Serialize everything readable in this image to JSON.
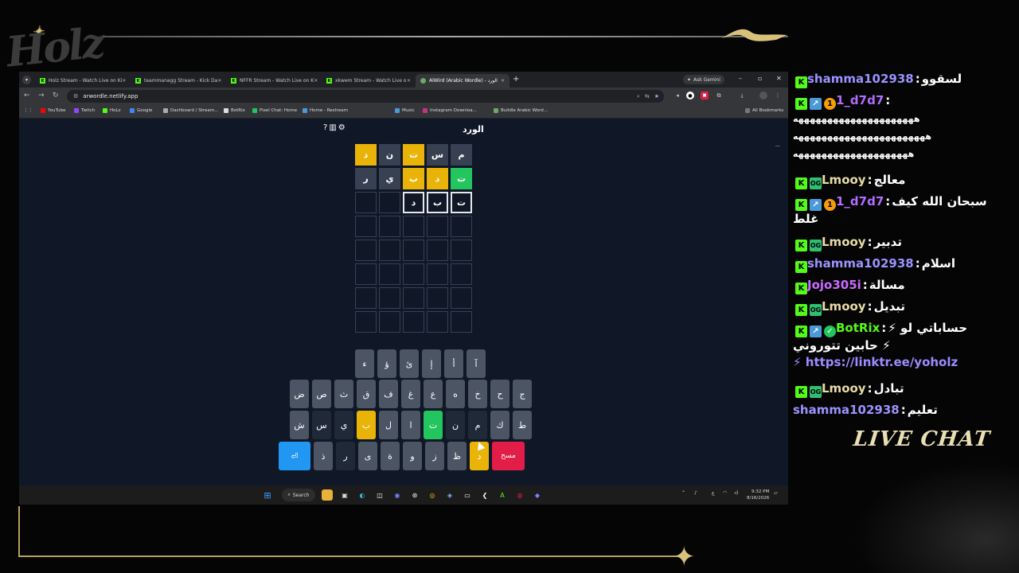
{
  "overlay": {
    "logo_text": "Holz",
    "live_chat_label": "LIVE CHAT"
  },
  "browser": {
    "tabs": [
      {
        "title": "Holz Stream - Watch Live on Ki"
      },
      {
        "title": "teammanagg Stream - Kick Da"
      },
      {
        "title": "NFFR Stream - Watch Live on K"
      },
      {
        "title": "xkwem Stream - Watch Live o"
      },
      {
        "title": "AlWird (Arabic Wordle) - الورد"
      }
    ],
    "ask_gemini": "Ask Gemini",
    "url": "arwordle.netlify.app",
    "bookmarks": [
      "YouTube",
      "Twitch",
      "HoLz",
      "Google",
      "Dashboard / Stream...",
      "BotRix",
      "Pixel Chat: Home",
      "Home - Restream",
      "Music",
      "Instagram Downloa...",
      "Buildle Arabic Word..."
    ],
    "all_bookmarks": "All Bookmarks"
  },
  "game": {
    "title": "الورد",
    "board": [
      [
        {
          "l": "م",
          "s": "absent"
        },
        {
          "l": "س",
          "s": "absent"
        },
        {
          "l": "ت",
          "s": "present"
        },
        {
          "l": "ن",
          "s": "absent"
        },
        {
          "l": "د",
          "s": "present"
        }
      ],
      [
        {
          "l": "ت",
          "s": "correct"
        },
        {
          "l": "د",
          "s": "present"
        },
        {
          "l": "ب",
          "s": "present"
        },
        {
          "l": "ي",
          "s": "absent"
        },
        {
          "l": "ر",
          "s": "absent"
        }
      ],
      [
        {
          "l": "ت",
          "s": "filled"
        },
        {
          "l": "ب",
          "s": "filled"
        },
        {
          "l": "د",
          "s": "filled"
        },
        {
          "l": "",
          "s": "empty"
        },
        {
          "l": "",
          "s": "empty"
        }
      ],
      [
        {
          "l": "",
          "s": "empty"
        },
        {
          "l": "",
          "s": "empty"
        },
        {
          "l": "",
          "s": "empty"
        },
        {
          "l": "",
          "s": "empty"
        },
        {
          "l": "",
          "s": "empty"
        }
      ],
      [
        {
          "l": "",
          "s": "empty"
        },
        {
          "l": "",
          "s": "empty"
        },
        {
          "l": "",
          "s": "empty"
        },
        {
          "l": "",
          "s": "empty"
        },
        {
          "l": "",
          "s": "empty"
        }
      ],
      [
        {
          "l": "",
          "s": "empty"
        },
        {
          "l": "",
          "s": "empty"
        },
        {
          "l": "",
          "s": "empty"
        },
        {
          "l": "",
          "s": "empty"
        },
        {
          "l": "",
          "s": "empty"
        }
      ],
      [
        {
          "l": "",
          "s": "empty"
        },
        {
          "l": "",
          "s": "empty"
        },
        {
          "l": "",
          "s": "empty"
        },
        {
          "l": "",
          "s": "empty"
        },
        {
          "l": "",
          "s": "empty"
        }
      ],
      [
        {
          "l": "",
          "s": "empty"
        },
        {
          "l": "",
          "s": "empty"
        },
        {
          "l": "",
          "s": "empty"
        },
        {
          "l": "",
          "s": "empty"
        },
        {
          "l": "",
          "s": "empty"
        }
      ]
    ],
    "keyboard": [
      [
        {
          "l": "آ",
          "s": "unused"
        },
        {
          "l": "أ",
          "s": "unused"
        },
        {
          "l": "إ",
          "s": "unused"
        },
        {
          "l": "ئ",
          "s": "unused"
        },
        {
          "l": "ؤ",
          "s": "unused"
        },
        {
          "l": "ء",
          "s": "unused"
        }
      ],
      [
        {
          "l": "ج",
          "s": "unused"
        },
        {
          "l": "ح",
          "s": "unused"
        },
        {
          "l": "خ",
          "s": "unused"
        },
        {
          "l": "ه",
          "s": "unused"
        },
        {
          "l": "ع",
          "s": "unused"
        },
        {
          "l": "غ",
          "s": "unused"
        },
        {
          "l": "ف",
          "s": "unused"
        },
        {
          "l": "ق",
          "s": "unused"
        },
        {
          "l": "ث",
          "s": "unused"
        },
        {
          "l": "ص",
          "s": "unused"
        },
        {
          "l": "ض",
          "s": "unused"
        }
      ],
      [
        {
          "l": "ط",
          "s": "unused"
        },
        {
          "l": "ك",
          "s": "unused"
        },
        {
          "l": "م",
          "s": "absent"
        },
        {
          "l": "ن",
          "s": "absent"
        },
        {
          "l": "ت",
          "s": "correct"
        },
        {
          "l": "ا",
          "s": "unused"
        },
        {
          "l": "ل",
          "s": "unused"
        },
        {
          "l": "ب",
          "s": "present"
        },
        {
          "l": "ي",
          "s": "absent"
        },
        {
          "l": "س",
          "s": "absent"
        },
        {
          "l": "ش",
          "s": "unused"
        }
      ],
      [
        {
          "l": "مسح",
          "s": "del"
        },
        {
          "l": "د",
          "s": "present"
        },
        {
          "l": "ظ",
          "s": "unused"
        },
        {
          "l": "ز",
          "s": "unused"
        },
        {
          "l": "و",
          "s": "unused"
        },
        {
          "l": "ة",
          "s": "unused"
        },
        {
          "l": "ى",
          "s": "unused"
        },
        {
          "l": "ر",
          "s": "absent"
        },
        {
          "l": "ذ",
          "s": "unused"
        },
        {
          "l": "⏎",
          "s": "enter"
        }
      ]
    ]
  },
  "taskbar": {
    "search": "Search",
    "lang": "ع",
    "time": "9:32 PM",
    "date": "8/16/2026"
  },
  "chat": [
    {
      "user": "shamma102938",
      "color": "#9b93ff",
      "badges": [
        "kick"
      ],
      "lines": [
        "لسقوو"
      ]
    },
    {
      "user": "1_d7d7",
      "color": "#b36cff",
      "badges": [
        "kick",
        "sub",
        "gift"
      ],
      "lines": [
        "",
        "هههههههههههههههههههههه",
        "هههههههههههههههههههههههه",
        "ههههههههههههههههههههه"
      ]
    },
    {
      "user": "Lmooy",
      "color": "#e8dca5",
      "badges": [
        "kick",
        "og"
      ],
      "lines": [
        "معالج"
      ]
    },
    {
      "user": "1_d7d7",
      "color": "#b36cff",
      "badges": [
        "kick",
        "sub",
        "gift"
      ],
      "lines": [
        "سبحان الله كيف",
        "غلط"
      ]
    },
    {
      "user": "Lmooy",
      "color": "#e8dca5",
      "badges": [
        "kick",
        "og"
      ],
      "lines": [
        "تدبير"
      ]
    },
    {
      "user": "shamma102938",
      "color": "#9b93ff",
      "badges": [
        "kick"
      ],
      "lines": [
        "اسلام"
      ]
    },
    {
      "user": "Jojo305i",
      "color": "#c86bff",
      "badges": [
        "kick"
      ],
      "lines": [
        "مسالة"
      ]
    },
    {
      "user": "Lmooy",
      "color": "#e8dca5",
      "badges": [
        "kick",
        "og"
      ],
      "lines": [
        "تبديل"
      ]
    },
    {
      "user": "BotRix",
      "color": "#53fc18",
      "badges": [
        "kick",
        "sub",
        "ver"
      ],
      "lines": [
        "⚡ حساباتي لو",
        "⚡ حابين تتوروني",
        "https://linktr.ee/yoholz ⚡"
      ]
    },
    {
      "user": "Lmooy",
      "color": "#e8dca5",
      "badges": [
        "kick",
        "og"
      ],
      "lines": [
        "تبادل"
      ]
    },
    {
      "user": "shamma102938",
      "color": "#9b93ff",
      "badges": [],
      "lines": [
        "تعليم"
      ]
    }
  ],
  "colors": {
    "correct": "#22c55e",
    "present": "#eab308",
    "absent": "#374151",
    "enter": "#2196f3",
    "delete": "#e11d48",
    "page_bg": "#101828"
  }
}
